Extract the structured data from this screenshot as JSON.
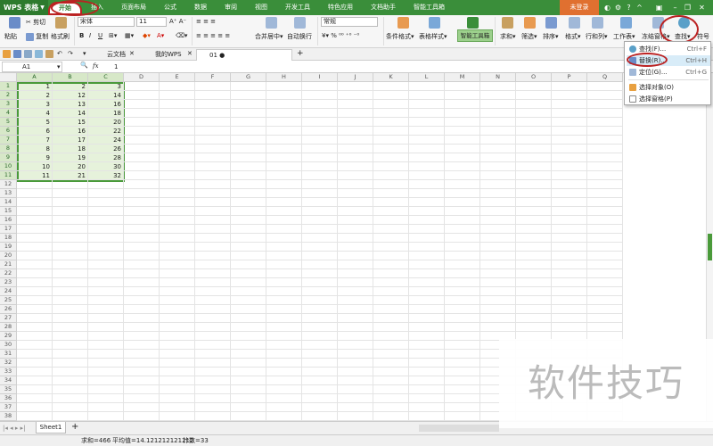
{
  "menubar": {
    "logo": "WPS 表格",
    "tabs": [
      "开始",
      "插入",
      "页面布局",
      "公式",
      "数据",
      "审阅",
      "视图",
      "开发工具",
      "特色应用",
      "文档助手",
      "智能工具箱"
    ],
    "active_tab": "开始",
    "login_label": "未登录"
  },
  "ribbon": {
    "paste": "粘贴",
    "cut": "剪切",
    "copy": "复制",
    "format_painter": "格式刷",
    "font_name": "宋体",
    "font_size": "11",
    "merge_center": "合并居中",
    "wrap_text": "自动换行",
    "number_format": "常规",
    "cond_format": "条件格式",
    "table_style": "表格样式",
    "smart_toolbox": "智能工具箱",
    "sum": "求和",
    "filter": "筛选",
    "sort": "排序",
    "format": "格式",
    "row_col": "行和列",
    "worksheet": "工作表",
    "freeze": "冻结窗格",
    "find": "查找",
    "symbol": "符号"
  },
  "tabs_bar": {
    "cloud_doc": "云文档",
    "my_wps": "我的WPS",
    "doc_tab": "01"
  },
  "formula_bar": {
    "cell_ref": "A1",
    "fx": "fx",
    "value": "1"
  },
  "grid": {
    "columns": [
      "A",
      "B",
      "C",
      "D",
      "E",
      "F",
      "G",
      "H",
      "I",
      "J",
      "K",
      "L",
      "M",
      "N",
      "O",
      "P",
      "Q"
    ],
    "row_count": 38,
    "data": [
      [
        1,
        2,
        3
      ],
      [
        2,
        12,
        14
      ],
      [
        3,
        13,
        16
      ],
      [
        4,
        14,
        18
      ],
      [
        5,
        15,
        20
      ],
      [
        6,
        16,
        22
      ],
      [
        7,
        17,
        24
      ],
      [
        8,
        18,
        26
      ],
      [
        9,
        19,
        28
      ],
      [
        10,
        20,
        30
      ],
      [
        11,
        21,
        32
      ]
    ]
  },
  "sheets": [
    "Sheet1"
  ],
  "add_sheet": "+",
  "status": {
    "sum": "求和=466",
    "avg": "平均值=14.121212121212",
    "count": "计数=33"
  },
  "find_menu": {
    "items": [
      {
        "label": "查找(F)...",
        "key": "Ctrl+F"
      },
      {
        "label": "替换(R)...",
        "key": "Ctrl+H"
      },
      {
        "label": "定位(G)...",
        "key": "Ctrl+G"
      },
      {
        "label": "选择对象(O)",
        "key": ""
      },
      {
        "label": "选择窗格(P)",
        "key": ""
      }
    ]
  },
  "watermark": "软件技巧",
  "colors": {
    "accent": "#3a8e3a",
    "selection": "#e6f2db",
    "highlight": "#b22222"
  }
}
